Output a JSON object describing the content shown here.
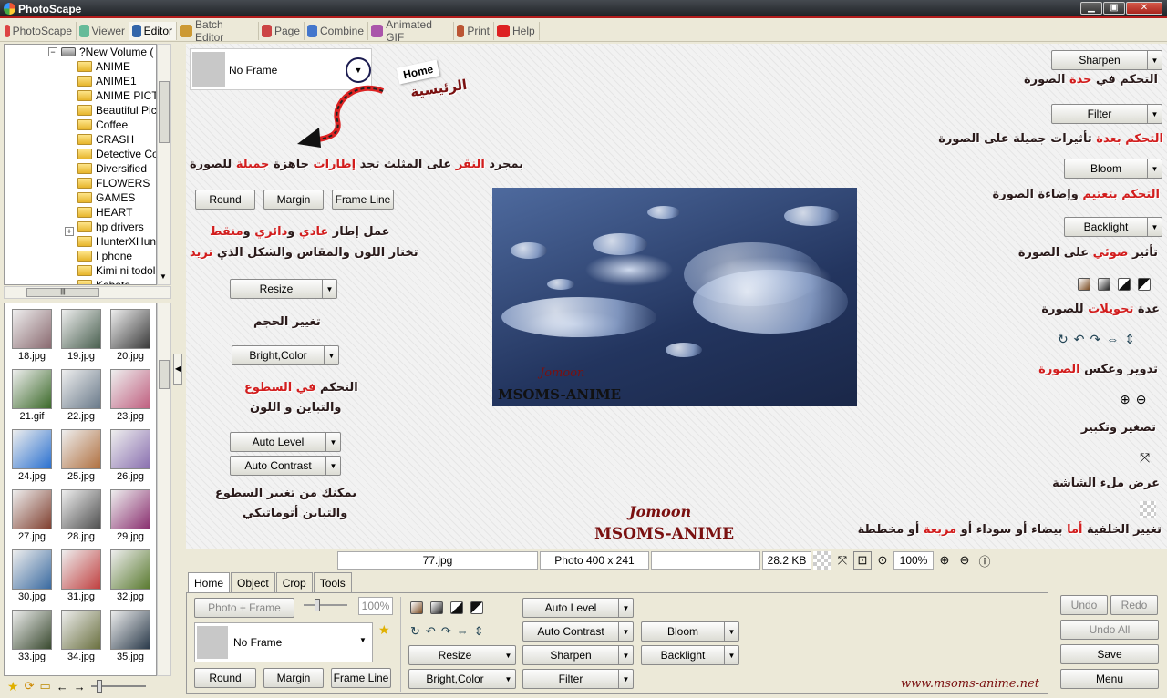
{
  "window": {
    "title": "PhotoScape"
  },
  "menu": {
    "tabs": [
      {
        "label": "PhotoScape",
        "icon": "photoscape-icon",
        "color": "#d44"
      },
      {
        "label": "Viewer",
        "icon": "viewer-icon",
        "color": "#6b9"
      },
      {
        "label": "Editor",
        "icon": "editor-icon",
        "color": "#36a"
      },
      {
        "label": "Batch Editor",
        "icon": "batch-editor-icon",
        "color": "#c93"
      },
      {
        "label": "Page",
        "icon": "page-icon",
        "color": "#c44"
      },
      {
        "label": "Combine",
        "icon": "combine-icon",
        "color": "#47c"
      },
      {
        "label": "Animated GIF",
        "icon": "animated-gif-icon",
        "color": "#a5a"
      },
      {
        "label": "Print",
        "icon": "print-icon",
        "color": "#b53"
      },
      {
        "label": "Help",
        "icon": "help-icon",
        "color": "#d22"
      }
    ]
  },
  "tree": {
    "root": "?New Volume (",
    "folders": [
      "ANIME",
      "ANIME1",
      "ANIME PICT",
      "Beautiful Pic",
      "Coffee",
      "CRASH",
      "Detective Co",
      "Diversified",
      "FLOWERS",
      "GAMES",
      "HEART",
      "hp drivers",
      "HunterXHun",
      "I phone",
      "Kimi ni todol",
      "Kobato"
    ]
  },
  "thumbnails": [
    "18.jpg",
    "19.jpg",
    "20.jpg",
    "21.gif",
    "22.jpg",
    "23.jpg",
    "24.jpg",
    "25.jpg",
    "26.jpg",
    "27.jpg",
    "28.jpg",
    "29.jpg",
    "30.jpg",
    "31.jpg",
    "32.jpg",
    "33.jpg",
    "34.jpg",
    "35.jpg"
  ],
  "canvas": {
    "frame": {
      "label": "No Frame"
    },
    "home_badge": "Home",
    "home_ar": "الرئيسية",
    "buttons": {
      "round": "Round",
      "margin": "Margin",
      "frame_line": "Frame Line",
      "resize": "Resize",
      "bright_color": "Bright,Color",
      "auto_level": "Auto Level",
      "auto_contrast": "Auto Contrast"
    },
    "right_dropdowns": {
      "sharpen": "Sharpen",
      "filter": "Filter",
      "bloom": "Bloom",
      "backlight": "Backlight"
    },
    "ann": {
      "frames_a": "بمجرد ",
      "frames_b": "النقر",
      "frames_c": " على المثلث تجد ",
      "frames_d": "إطارات",
      "frames_e": " جاهزة ",
      "frames_f": "جميلة",
      "frames_g": " للصورة",
      "border1_a": "عمل إطار ",
      "border1_b": "عادي",
      "border1_c": " و",
      "border1_d": "دائري",
      "border1_e": " و",
      "border1_f": "منقط",
      "border2_a": "تختار اللون والمقاس والشكل الذي ",
      "border2_b": "تريد",
      "resize": "تغيير الحجم",
      "bright1_a": "التحكم ",
      "bright1_b": "في السطوع",
      "bright2": "والتباين و اللون",
      "auto1": "يمكنك من تغيير السطوع",
      "auto2": "والتباين أتوماتيكي",
      "sharpen_a": "التحكم في ",
      "sharpen_b": "حدة",
      "sharpen_c": " الصورة",
      "filter_a": "التحكم ",
      "filter_b": "بعدة",
      "filter_c": " تأثيرات جميلة على الصورة",
      "bloom_a": "التحكم ",
      "bloom_b": "بتعتيم",
      "bloom_c": " وإضاءة الصورة",
      "backlight_a": "تأثير ",
      "backlight_b": "ضوئي",
      "backlight_c": " على الصورة",
      "transforms_a": "عدة ",
      "transforms_b": "تحويلات",
      "transforms_c": " للصورة",
      "rotate_a": "تدوير وعكس ",
      "rotate_b": "الصورة",
      "zoom": "تصغير وتكبير",
      "fullscreen": "عرض ملء الشاشة",
      "bg_a": "تغيير الخلفية ",
      "bg_b": "أما",
      "bg_c": " بيضاء أو سوداء أو ",
      "bg_d": "مربعة",
      "bg_e": " أو مخططة"
    },
    "watermark": {
      "name": "Jomoon",
      "site": "MSOMS-ANIME"
    }
  },
  "photo": {
    "watermark1": "Jomoon",
    "watermark2": "MSOMS-ANIME"
  },
  "status": {
    "filename": "77.jpg",
    "dims": "Photo 400 x 241",
    "size": "28.2 KB",
    "zoom": "100%"
  },
  "editor_tabs": [
    "Home",
    "Object",
    "Crop",
    "Tools"
  ],
  "panel": {
    "photo_frame": "Photo + Frame",
    "opacity": "100%",
    "frame": "No Frame",
    "round": "Round",
    "margin": "Margin",
    "frame_line": "Frame Line",
    "resize": "Resize",
    "bright_color": "Bright,Color",
    "auto_level": "Auto Level",
    "auto_contrast": "Auto Contrast",
    "sharpen": "Sharpen",
    "filter": "Filter",
    "bloom": "Bloom",
    "backlight": "Backlight"
  },
  "right": {
    "undo": "Undo",
    "redo": "Redo",
    "undo_all": "Undo All",
    "save": "Save",
    "menu": "Menu"
  },
  "footer_site": "www.msoms-anime.net"
}
